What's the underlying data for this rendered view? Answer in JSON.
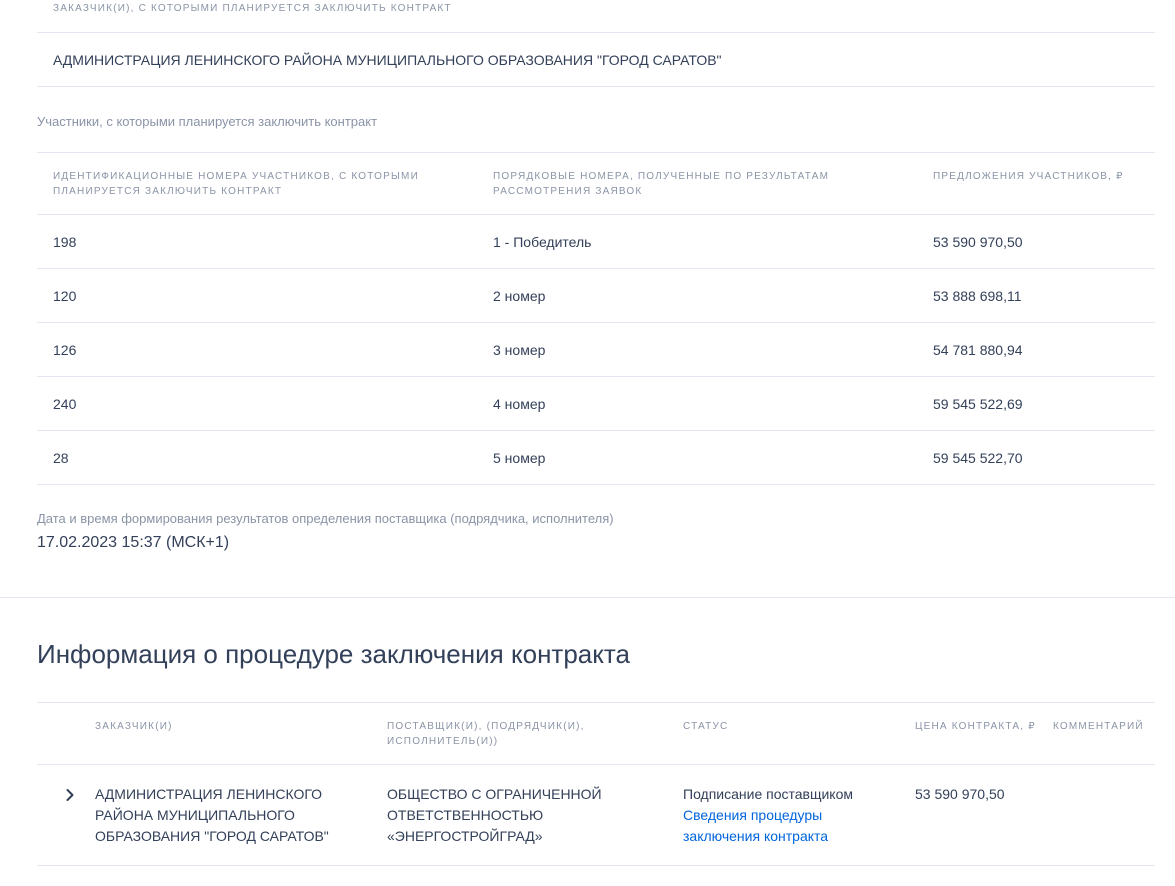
{
  "customers_section": {
    "header": "ЗАКАЗЧИК(И), С КОТОРЫМИ ПЛАНИРУЕТСЯ ЗАКЛЮЧИТЬ КОНТРАКТ",
    "customer_name": "АДМИНИСТРАЦИЯ ЛЕНИНСКОГО РАЙОНА МУНИЦИПАЛЬНОГО ОБРАЗОВАНИЯ \"ГОРОД САРАТОВ\""
  },
  "participants_section": {
    "title": "Участники, с которыми планируется заключить контракт",
    "columns": [
      "ИДЕНТИФИКАЦИОННЫЕ НОМЕРА УЧАСТНИКОВ, С КОТОРЫМИ ПЛАНИРУЕТСЯ ЗАКЛЮЧИТЬ КОНТРАКТ",
      "ПОРЯДКОВЫЕ НОМЕРА, ПОЛУЧЕННЫЕ ПО РЕЗУЛЬТАТАМ РАССМОТРЕНИЯ ЗАЯВОК",
      "ПРЕДЛОЖЕНИЯ УЧАСТНИКОВ, ₽"
    ],
    "rows": [
      {
        "id": "198",
        "rank": "1 - Победитель",
        "offer": "53 590 970,50"
      },
      {
        "id": "120",
        "rank": "2 номер",
        "offer": "53 888 698,11"
      },
      {
        "id": "126",
        "rank": "3 номер",
        "offer": "54 781 880,94"
      },
      {
        "id": "240",
        "rank": "4 номер",
        "offer": "59 545 522,69"
      },
      {
        "id": "28",
        "rank": "5 номер",
        "offer": "59 545 522,70"
      }
    ]
  },
  "results_date": {
    "label": "Дата и время формирования результатов определения поставщика (подрядчика, исполнителя)",
    "value": "17.02.2023 15:37 (МСК+1)"
  },
  "contract_section": {
    "title": "Информация о процедуре заключения контракта",
    "columns": {
      "customer": "ЗАКАЗЧИК(И)",
      "supplier": "ПОСТАВЩИК(И), (ПОДРЯДЧИК(И), ИСПОЛНИТЕЛЬ(И))",
      "status": "СТАТУС",
      "price": "ЦЕНА КОНТРАКТА, ₽",
      "comment": "КОММЕНТАРИЙ"
    },
    "row": {
      "customer": "АДМИНИСТРАЦИЯ ЛЕНИНСКОГО РАЙОНА МУНИЦИПАЛЬНОГО ОБРАЗОВАНИЯ \"ГОРОД САРАТОВ\"",
      "supplier": "ОБЩЕСТВО С ОГРАНИЧЕННОЙ ОТВЕТСТВЕННОСТЬЮ «ЭНЕРГОСТРОЙГРАД»",
      "status": "Подписание поставщиком",
      "status_link": "Сведения процедуры заключения контракта",
      "price": "53 590 970,50",
      "comment": ""
    },
    "expand_icon": "chevron-right-icon"
  },
  "colors": {
    "text_primary": "#334059",
    "text_muted": "#8a94a6",
    "border": "#e4e7f2",
    "link": "#0065dd"
  }
}
